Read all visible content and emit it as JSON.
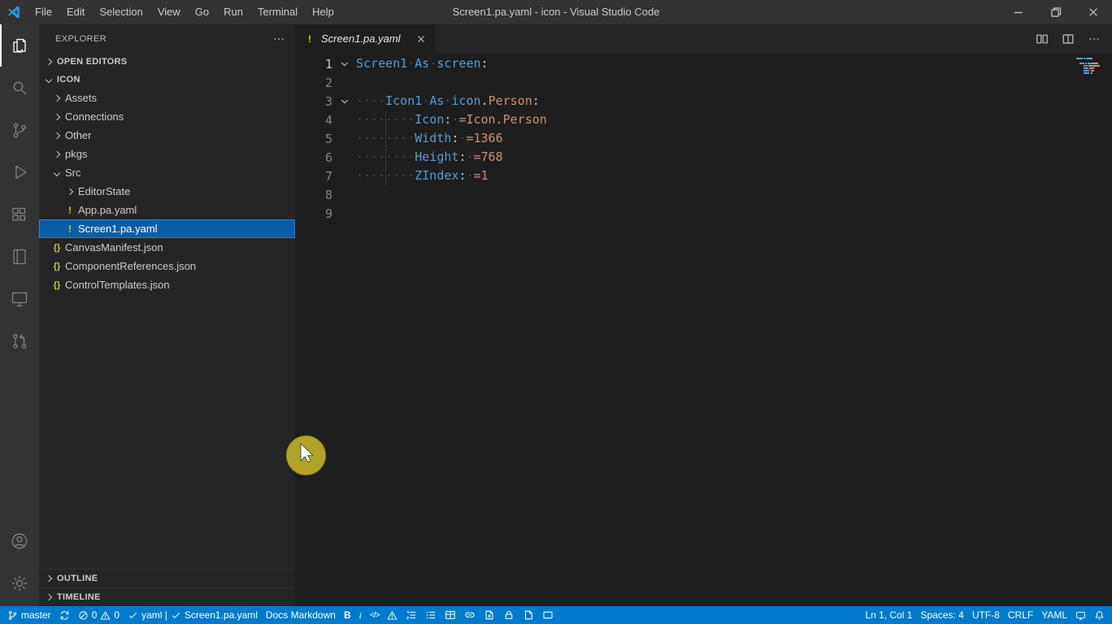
{
  "titlebar": {
    "title": "Screen1.pa.yaml - icon - Visual Studio Code",
    "menus": [
      "File",
      "Edit",
      "Selection",
      "View",
      "Go",
      "Run",
      "Terminal",
      "Help"
    ]
  },
  "activitybar": {
    "top": [
      {
        "name": "explorer",
        "icon": "files",
        "active": true
      },
      {
        "name": "search",
        "icon": "search"
      },
      {
        "name": "source-control",
        "icon": "source-control"
      },
      {
        "name": "run-and-debug",
        "icon": "run-debug"
      },
      {
        "name": "extensions",
        "icon": "extensions"
      },
      {
        "name": "notebook",
        "icon": "notebook"
      },
      {
        "name": "remote-explorer",
        "icon": "remote-explorer"
      },
      {
        "name": "github-pull-requests",
        "icon": "github-pr"
      }
    ],
    "bottom": [
      {
        "name": "accounts",
        "icon": "account"
      },
      {
        "name": "manage",
        "icon": "gear"
      }
    ]
  },
  "sidebar": {
    "title": "EXPLORER",
    "open_editors_label": "OPEN EDITORS",
    "folder_label": "ICON",
    "outline_label": "OUTLINE",
    "timeline_label": "TIMELINE",
    "file_icons": {
      "yaml": "!",
      "json": "{}"
    },
    "tree": [
      {
        "label": "Assets",
        "kind": "folder",
        "depth": 1,
        "expanded": false
      },
      {
        "label": "Connections",
        "kind": "folder",
        "depth": 1,
        "expanded": false
      },
      {
        "label": "Other",
        "kind": "folder",
        "depth": 1,
        "expanded": false
      },
      {
        "label": "pkgs",
        "kind": "folder",
        "depth": 1,
        "expanded": false
      },
      {
        "label": "Src",
        "kind": "folder",
        "depth": 1,
        "expanded": true
      },
      {
        "label": "EditorState",
        "kind": "folder",
        "depth": 2,
        "expanded": false
      },
      {
        "label": "App.pa.yaml",
        "kind": "yaml",
        "depth": 2
      },
      {
        "label": "Screen1.pa.yaml",
        "kind": "yaml",
        "depth": 2,
        "selected": true
      },
      {
        "label": "CanvasManifest.json",
        "kind": "json",
        "depth": 1
      },
      {
        "label": "ComponentReferences.json",
        "kind": "json",
        "depth": 1
      },
      {
        "label": "ControlTemplates.json",
        "kind": "json",
        "depth": 1
      }
    ]
  },
  "editor": {
    "tab_label": "Screen1.pa.yaml",
    "active_line": 1,
    "actions": [
      {
        "name": "open-changes",
        "icon": "open-changes"
      },
      {
        "name": "split-editor",
        "icon": "split"
      },
      {
        "name": "more-actions",
        "icon": "ellipsis"
      }
    ],
    "code_lines": [
      {
        "n": 1,
        "fold": true,
        "tokens": [
          {
            "c": "key",
            "t": "Screen1"
          },
          {
            "c": "ws",
            "t": "·"
          },
          {
            "c": "key",
            "t": "As"
          },
          {
            "c": "ws",
            "t": "·"
          },
          {
            "c": "key",
            "t": "screen"
          },
          {
            "c": "punct",
            "t": ":"
          }
        ]
      },
      {
        "n": 2,
        "tokens": []
      },
      {
        "n": 3,
        "fold": true,
        "tokens": [
          {
            "c": "ws",
            "t": "····"
          },
          {
            "c": "key",
            "t": "Icon1"
          },
          {
            "c": "ws",
            "t": "·"
          },
          {
            "c": "key",
            "t": "As"
          },
          {
            "c": "ws",
            "t": "·"
          },
          {
            "c": "key",
            "t": "icon"
          },
          {
            "c": "punct",
            "t": "."
          },
          {
            "c": "val",
            "t": "Person"
          },
          {
            "c": "punct",
            "t": ":"
          }
        ]
      },
      {
        "n": 4,
        "tokens": [
          {
            "c": "ws",
            "t": "····"
          },
          {
            "c": "guide",
            "t": ""
          },
          {
            "c": "ws",
            "t": "····"
          },
          {
            "c": "key",
            "t": "Icon"
          },
          {
            "c": "punct",
            "t": ":"
          },
          {
            "c": "ws",
            "t": "·"
          },
          {
            "c": "val",
            "t": "=Icon.Person"
          }
        ]
      },
      {
        "n": 5,
        "tokens": [
          {
            "c": "ws",
            "t": "····"
          },
          {
            "c": "guide",
            "t": ""
          },
          {
            "c": "ws",
            "t": "····"
          },
          {
            "c": "key",
            "t": "Width"
          },
          {
            "c": "punct",
            "t": ":"
          },
          {
            "c": "ws",
            "t": "·"
          },
          {
            "c": "val",
            "t": "=1366"
          }
        ]
      },
      {
        "n": 6,
        "tokens": [
          {
            "c": "ws",
            "t": "····"
          },
          {
            "c": "guide",
            "t": ""
          },
          {
            "c": "ws",
            "t": "····"
          },
          {
            "c": "key",
            "t": "Height"
          },
          {
            "c": "punct",
            "t": ":"
          },
          {
            "c": "ws",
            "t": "·"
          },
          {
            "c": "val",
            "t": "=768"
          }
        ]
      },
      {
        "n": 7,
        "tokens": [
          {
            "c": "ws",
            "t": "····"
          },
          {
            "c": "guide",
            "t": ""
          },
          {
            "c": "ws",
            "t": "····"
          },
          {
            "c": "key",
            "t": "ZIndex"
          },
          {
            "c": "punct",
            "t": ":"
          },
          {
            "c": "ws",
            "t": "·"
          },
          {
            "c": "val",
            "t": "=1"
          }
        ]
      },
      {
        "n": 8,
        "tokens": []
      },
      {
        "n": 9,
        "tokens": []
      }
    ]
  },
  "statusbar": {
    "left": [
      {
        "name": "git-branch",
        "parts": [
          {
            "icon": "branch"
          },
          {
            "text": "master"
          }
        ]
      },
      {
        "name": "sync-changes",
        "parts": [
          {
            "icon": "sync"
          }
        ]
      },
      {
        "name": "problems",
        "parts": [
          {
            "icon": "error"
          },
          {
            "text": "0"
          },
          {
            "icon": "warning"
          },
          {
            "text": "0"
          }
        ]
      },
      {
        "name": "yaml-status",
        "parts": [
          {
            "icon": "check"
          },
          {
            "text": "yaml |"
          },
          {
            "icon": "check"
          },
          {
            "text": "Screen1.pa.yaml"
          }
        ]
      },
      {
        "name": "docs-markdown",
        "parts": [
          {
            "text": "Docs Markdown"
          }
        ]
      },
      {
        "name": "format-bold",
        "parts": [
          {
            "icon": "bold"
          }
        ]
      },
      {
        "name": "format-italic",
        "parts": [
          {
            "icon": "italic"
          }
        ]
      },
      {
        "name": "format-code",
        "parts": [
          {
            "icon": "code"
          }
        ]
      },
      {
        "name": "insert-alert",
        "parts": [
          {
            "icon": "warning"
          }
        ]
      },
      {
        "name": "insert-numbered-list",
        "parts": [
          {
            "icon": "numbered-list"
          }
        ]
      },
      {
        "name": "insert-bullet-list",
        "parts": [
          {
            "icon": "bullet-list"
          }
        ]
      },
      {
        "name": "insert-table",
        "parts": [
          {
            "icon": "table"
          }
        ]
      },
      {
        "name": "insert-link",
        "parts": [
          {
            "icon": "link"
          }
        ]
      },
      {
        "name": "insert-image",
        "parts": [
          {
            "icon": "file-export"
          }
        ]
      },
      {
        "name": "insert-lock",
        "parts": [
          {
            "icon": "lock"
          }
        ]
      },
      {
        "name": "insert-include",
        "parts": [
          {
            "icon": "file"
          }
        ]
      },
      {
        "name": "insert-snippet",
        "parts": [
          {
            "icon": "frame"
          }
        ]
      }
    ],
    "right": [
      {
        "name": "cursor-position",
        "parts": [
          {
            "text": "Ln 1, Col 1"
          }
        ]
      },
      {
        "name": "indentation",
        "parts": [
          {
            "text": "Spaces: 4"
          }
        ]
      },
      {
        "name": "encoding",
        "parts": [
          {
            "text": "UTF-8"
          }
        ]
      },
      {
        "name": "eol",
        "parts": [
          {
            "text": "CRLF"
          }
        ]
      },
      {
        "name": "language-mode",
        "parts": [
          {
            "text": "YAML"
          }
        ]
      },
      {
        "name": "remote-indicator",
        "parts": [
          {
            "icon": "remote"
          }
        ]
      },
      {
        "name": "notifications",
        "parts": [
          {
            "icon": "bell"
          }
        ]
      }
    ]
  },
  "colors": {
    "statusbar": "#007acc",
    "titlebar": "#323233",
    "activitybar": "#333333",
    "sidebar": "#252526",
    "editor": "#1e1e1e",
    "selection": "#0b5da5",
    "token_key": "#569cd6",
    "token_value": "#ce9178",
    "yaml_icon": "#e8c217",
    "json_icon": "#cbcb41",
    "cursor_highlight": "#b0a325"
  }
}
